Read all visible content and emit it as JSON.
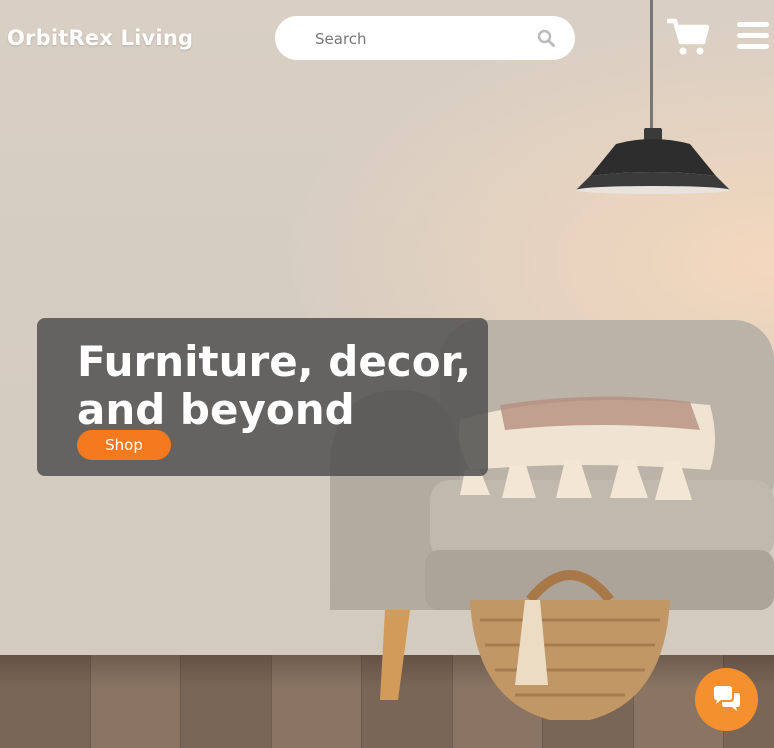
{
  "header": {
    "brand": "OrbitRex Living",
    "search": {
      "placeholder": "Search",
      "value": ""
    },
    "icons": [
      "search-icon",
      "cart-icon",
      "menu-icon"
    ]
  },
  "hero": {
    "title": "Furniture, decor, and beyond",
    "cta_label": "Shop"
  },
  "chat": {
    "icon": "chat-icon"
  },
  "colors": {
    "accent": "#f57a1f",
    "chat": "#f5902e",
    "hero_overlay": "#505050"
  }
}
